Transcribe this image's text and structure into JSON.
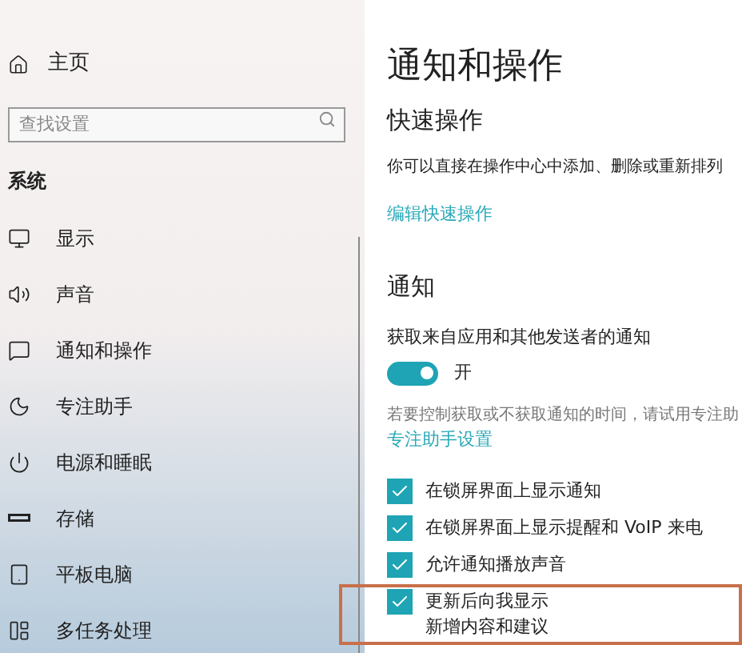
{
  "home": "主页",
  "search": {
    "placeholder": "查找设置"
  },
  "section": "系统",
  "nav": [
    {
      "label": "显示",
      "kind": "display"
    },
    {
      "label": "声音",
      "kind": "sound"
    },
    {
      "label": "通知和操作",
      "kind": "notify"
    },
    {
      "label": "专注助手",
      "kind": "focus"
    },
    {
      "label": "电源和睡眠",
      "kind": "power"
    },
    {
      "label": "存储",
      "kind": "storage"
    },
    {
      "label": "平板电脑",
      "kind": "tablet"
    },
    {
      "label": "多任务处理",
      "kind": "multitask"
    }
  ],
  "page": {
    "title": "通知和操作",
    "quick_heading": "快速操作",
    "quick_desc": "你可以直接在操作中心中添加、删除或重新排列",
    "quick_link": "编辑快速操作",
    "notify_heading": "通知",
    "toggle_label": "获取来自应用和其他发送者的通知",
    "toggle": {
      "on": true,
      "text": "开"
    },
    "focus_desc": "若要控制获取或不获取通知的时间，请试用专注助",
    "focus_link": "专注助手设置",
    "options": [
      {
        "lines": [
          "在锁屏界面上显示通知"
        ],
        "checked": true,
        "highlighted": false
      },
      {
        "lines": [
          "在锁屏界面上显示提醒和 VoIP 来电"
        ],
        "checked": true,
        "highlighted": false
      },
      {
        "lines": [
          "允许通知播放声音"
        ],
        "checked": true,
        "highlighted": false
      },
      {
        "lines": [
          "更新后向我显示",
          "新增内容和建议"
        ],
        "checked": true,
        "highlighted": true
      }
    ]
  }
}
